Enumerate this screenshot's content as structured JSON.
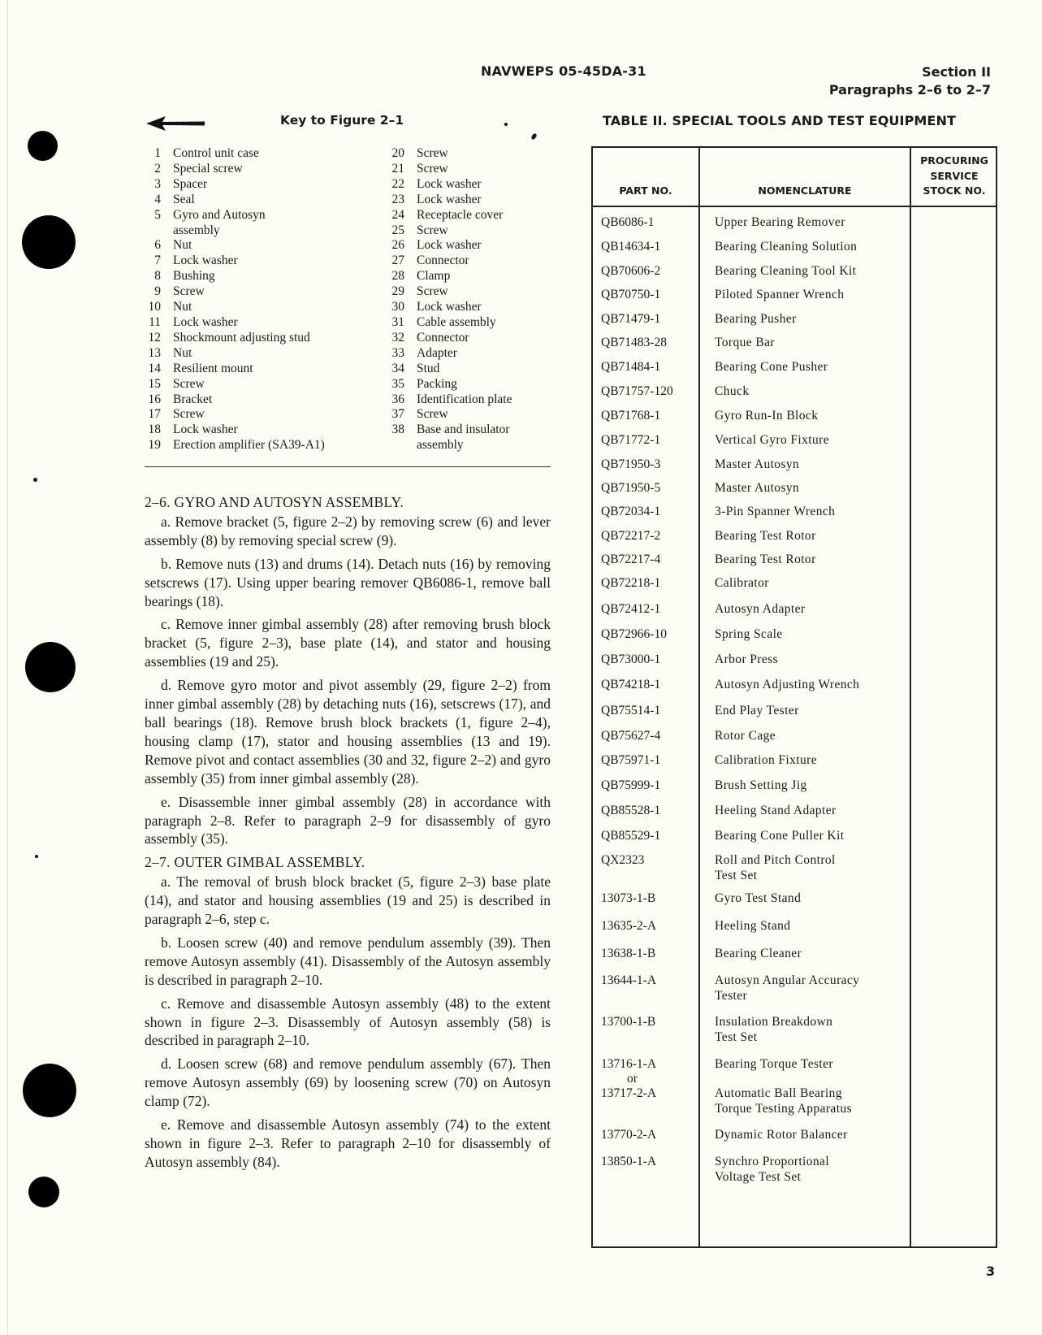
{
  "header": {
    "document_number": "NAVWEPS 05-45DA-31",
    "section": "Section II",
    "paragraphs": "Paragraphs 2–6 to 2–7"
  },
  "key": {
    "title": "Key to Figure 2–1",
    "arrow_icon": "left-arrow-icon",
    "left_column": [
      {
        "num": "1",
        "label": "Control unit case"
      },
      {
        "num": "2",
        "label": "Special screw"
      },
      {
        "num": "3",
        "label": "Spacer"
      },
      {
        "num": "4",
        "label": "Seal"
      },
      {
        "num": "5",
        "label": "Gyro and Autosyn\nassembly"
      },
      {
        "num": "6",
        "label": "Nut"
      },
      {
        "num": "7",
        "label": "Lock washer"
      },
      {
        "num": "8",
        "label": "Bushing"
      },
      {
        "num": "9",
        "label": "Screw"
      },
      {
        "num": "10",
        "label": "Nut"
      },
      {
        "num": "11",
        "label": "Lock washer"
      },
      {
        "num": "12",
        "label": "Shockmount adjusting stud"
      },
      {
        "num": "13",
        "label": "Nut"
      },
      {
        "num": "14",
        "label": "Resilient mount"
      },
      {
        "num": "15",
        "label": "Screw"
      },
      {
        "num": "16",
        "label": "Bracket"
      },
      {
        "num": "17",
        "label": "Screw"
      },
      {
        "num": "18",
        "label": "Lock washer"
      },
      {
        "num": "19",
        "label": "Erection amplifier (SA39-A1)"
      }
    ],
    "right_column": [
      {
        "num": "20",
        "label": "Screw"
      },
      {
        "num": "21",
        "label": "Screw"
      },
      {
        "num": "22",
        "label": "Lock washer"
      },
      {
        "num": "23",
        "label": "Lock washer"
      },
      {
        "num": "24",
        "label": "Receptacle cover"
      },
      {
        "num": "25",
        "label": "Screw"
      },
      {
        "num": "26",
        "label": "Lock washer"
      },
      {
        "num": "27",
        "label": "Connector"
      },
      {
        "num": "28",
        "label": "Clamp"
      },
      {
        "num": "29",
        "label": "Screw"
      },
      {
        "num": "30",
        "label": "Lock washer"
      },
      {
        "num": "31",
        "label": "Cable assembly"
      },
      {
        "num": "32",
        "label": "Connector"
      },
      {
        "num": "33",
        "label": "Adapter"
      },
      {
        "num": "34",
        "label": "Stud"
      },
      {
        "num": "35",
        "label": "Packing"
      },
      {
        "num": "36",
        "label": "Identification plate"
      },
      {
        "num": "37",
        "label": "Screw"
      },
      {
        "num": "38",
        "label": "Base and insulator\nassembly"
      }
    ]
  },
  "sections": [
    {
      "heading": "2–6. GYRO AND AUTOSYN ASSEMBLY.",
      "paragraphs": [
        "a. Remove bracket (5, figure 2–2) by removing screw (6) and lever assembly (8) by removing special screw (9).",
        "b. Remove nuts (13) and drums (14). Detach nuts (16) by removing setscrews (17). Using upper bearing remover QB6086-1, remove ball bearings (18).",
        "c. Remove inner gimbal assembly (28) after removing brush block bracket (5, figure 2–3), base plate (14), and stator and housing assemblies (19 and 25).",
        "d. Remove gyro motor and pivot assembly (29, figure 2–2) from inner gimbal assembly (28) by detaching nuts (16), setscrews (17), and ball bearings (18). Remove brush block brackets (1, figure 2–4), housing clamp (17), stator and housing assemblies (13 and 19). Remove pivot and contact assemblies (30 and 32, figure 2–2) and gyro assembly (35) from inner gimbal assembly (28).",
        "e. Disassemble inner gimbal assembly (28) in accordance with paragraph 2–8. Refer to paragraph 2–9 for disassembly of gyro assembly (35)."
      ]
    },
    {
      "heading": "2–7. OUTER GIMBAL ASSEMBLY.",
      "paragraphs": [
        "a. The removal of brush block bracket (5, figure 2–3) base plate (14), and stator and housing assemblies (19 and 25) is described in paragraph 2–6, step c.",
        "b. Loosen screw (40) and remove pendulum assembly (39). Then remove Autosyn assembly (41). Disassembly of the Autosyn assembly is described in paragraph 2–10.",
        "c. Remove and disassemble Autosyn assembly (48) to the extent shown in figure 2–3. Disassembly of Autosyn assembly (58) is described in paragraph 2–10.",
        "d. Loosen screw (68) and remove pendulum assembly (67). Then remove Autosyn assembly (69) by loosening screw (70) on Autosyn clamp (72).",
        "e. Remove and disassemble Autosyn assembly (74) to the extent shown in figure 2–3. Refer to paragraph 2–10 for disassembly of Autosyn assembly (84)."
      ]
    }
  ],
  "table": {
    "title": "TABLE II. SPECIAL TOOLS AND TEST EQUIPMENT",
    "columns": [
      "PART NO.",
      "NOMENCLATURE",
      "PROCURING\nSERVICE\nSTOCK NO."
    ],
    "rows": [
      {
        "part_no": "QB6086-1",
        "nomenclature": "Upper Bearing Remover",
        "stock_no": ""
      },
      {
        "part_no": "QB14634-1",
        "nomenclature": "Bearing Cleaning Solution",
        "stock_no": ""
      },
      {
        "part_no": "QB70606-2",
        "nomenclature": "Bearing Cleaning Tool Kit",
        "stock_no": ""
      },
      {
        "part_no": "QB70750-1",
        "nomenclature": "Piloted Spanner Wrench",
        "stock_no": ""
      },
      {
        "part_no": "QB71479-1",
        "nomenclature": "Bearing Pusher",
        "stock_no": ""
      },
      {
        "part_no": "QB71483-28",
        "nomenclature": "Torque Bar",
        "stock_no": ""
      },
      {
        "part_no": "QB71484-1",
        "nomenclature": "Bearing Cone Pusher",
        "stock_no": ""
      },
      {
        "part_no": "QB71757-120",
        "nomenclature": "Chuck",
        "stock_no": ""
      },
      {
        "part_no": "QB71768-1",
        "nomenclature": "Gyro Run-In Block",
        "stock_no": ""
      },
      {
        "part_no": "QB71772-1",
        "nomenclature": "Vertical Gyro Fixture",
        "stock_no": ""
      },
      {
        "part_no": "QB71950-3",
        "nomenclature": "Master Autosyn",
        "stock_no": ""
      },
      {
        "part_no": "QB71950-5",
        "nomenclature": "Master Autosyn",
        "stock_no": ""
      },
      {
        "part_no": "QB72034-1",
        "nomenclature": "3-Pin Spanner Wrench",
        "stock_no": ""
      },
      {
        "part_no": "QB72217-2",
        "nomenclature": "Bearing Test Rotor",
        "stock_no": ""
      },
      {
        "part_no": "QB72217-4",
        "nomenclature": "Bearing Test Rotor",
        "stock_no": ""
      },
      {
        "part_no": "QB72218-1",
        "nomenclature": "Calibrator",
        "stock_no": ""
      },
      {
        "part_no": "QB72412-1",
        "nomenclature": "Autosyn Adapter",
        "stock_no": ""
      },
      {
        "part_no": "QB72966-10",
        "nomenclature": "Spring Scale",
        "stock_no": ""
      },
      {
        "part_no": "QB73000-1",
        "nomenclature": "Arbor Press",
        "stock_no": ""
      },
      {
        "part_no": "QB74218-1",
        "nomenclature": "Autosyn Adjusting Wrench",
        "stock_no": ""
      },
      {
        "part_no": "QB75514-1",
        "nomenclature": "End Play Tester",
        "stock_no": ""
      },
      {
        "part_no": "QB75627-4",
        "nomenclature": "Rotor Cage",
        "stock_no": ""
      },
      {
        "part_no": "QB75971-1",
        "nomenclature": "Calibration Fixture",
        "stock_no": ""
      },
      {
        "part_no": "QB75999-1",
        "nomenclature": "Brush Setting Jig",
        "stock_no": ""
      },
      {
        "part_no": "QB85528-1",
        "nomenclature": "Heeling Stand Adapter",
        "stock_no": ""
      },
      {
        "part_no": "QB85529-1",
        "nomenclature": "Bearing Cone Puller Kit",
        "stock_no": ""
      },
      {
        "part_no": "QX2323",
        "nomenclature": "Roll and Pitch Control\nTest Set",
        "stock_no": ""
      },
      {
        "part_no": "13073-1-B",
        "nomenclature": "Gyro Test Stand",
        "stock_no": ""
      },
      {
        "part_no": "13635-2-A",
        "nomenclature": "Heeling Stand",
        "stock_no": ""
      },
      {
        "part_no": "13638-1-B",
        "nomenclature": "Bearing Cleaner",
        "stock_no": ""
      },
      {
        "part_no": "13644-1-A",
        "nomenclature": "Autosyn Angular Accuracy\nTester",
        "stock_no": ""
      },
      {
        "part_no": "13700-1-B",
        "nomenclature": "Insulation Breakdown\nTest Set",
        "stock_no": ""
      },
      {
        "part_no": "13716-1-A\n     or",
        "nomenclature": "Bearing Torque Tester",
        "stock_no": ""
      },
      {
        "part_no": "13717-2-A",
        "nomenclature": "Automatic Ball Bearing\nTorque Testing Apparatus",
        "stock_no": ""
      },
      {
        "part_no": "13770-2-A",
        "nomenclature": "Dynamic Rotor Balancer",
        "stock_no": ""
      },
      {
        "part_no": "13850-1-A",
        "nomenclature": "Synchro Proportional\nVoltage Test Set",
        "stock_no": ""
      }
    ]
  },
  "footer": {
    "page_number": "3"
  }
}
